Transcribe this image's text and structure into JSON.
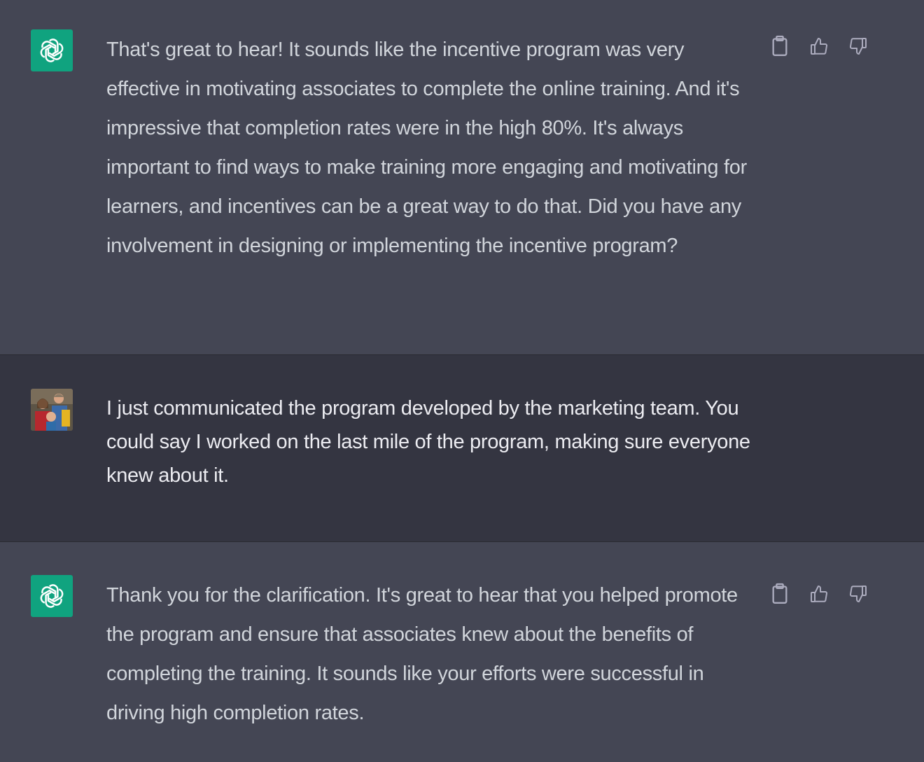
{
  "messages": [
    {
      "role": "assistant",
      "text": "That's great to hear! It sounds like the incentive program was very effective in motivating associates to complete the online training. And it's impressive that completion rates were in the high 80%. It's always important to find ways to make training more engaging and motivating for learners, and incentives can be a great way to do that. Did you have any involvement in designing or implementing the incentive program?",
      "avatar_icon": "openai-logo-icon"
    },
    {
      "role": "user",
      "text": "I just communicated the program developed by the marketing team. You could say I worked on the last mile of the program, making sure everyone knew about it.",
      "avatar_icon": "user-photo-avatar"
    },
    {
      "role": "assistant",
      "text": "Thank you for the clarification. It's great to hear that you helped promote the program and ensure that associates knew about the benefits of completing the training. It sounds like your efforts were successful in driving high completion rates.",
      "avatar_icon": "openai-logo-icon"
    }
  ],
  "action_icons": [
    "clipboard-icon",
    "thumbs-up-icon",
    "thumbs-down-icon"
  ],
  "colors": {
    "assistant_bg": "#444654",
    "user_bg": "#343541",
    "bot_avatar": "#10a37f",
    "text": "#d1d5db"
  }
}
